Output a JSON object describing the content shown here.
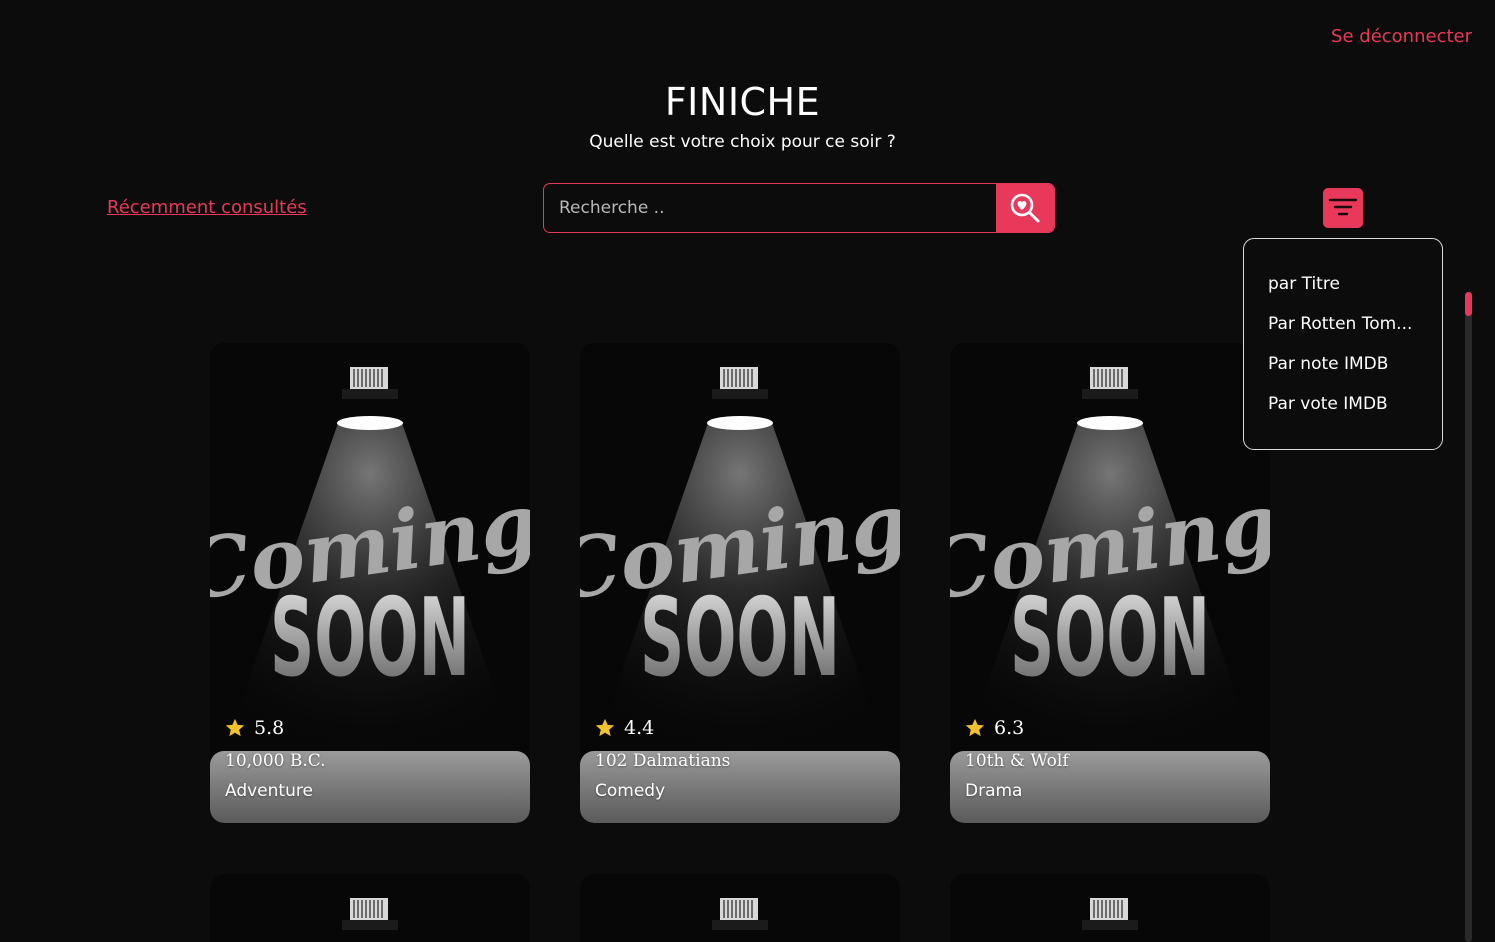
{
  "header": {
    "logout_label": "Se déconnecter",
    "brand": "FINICHE",
    "tagline": "Quelle est votre choix pour ce soir ?"
  },
  "toolbar": {
    "recent_label": "Récemment consultés",
    "search_placeholder": "Recherche ..",
    "search_icon": "magnifier-heart-icon",
    "filter_icon": "filter-lines-icon"
  },
  "sort_menu": {
    "options": [
      "par Titre",
      "Par Rotten Tom...",
      "Par note IMDB",
      "Par vote IMDB"
    ]
  },
  "movies": [
    {
      "rating": "5.8",
      "title": "10,000 B.C.",
      "genre": "Adventure",
      "poster_text_1": "Coming",
      "poster_text_2": "SOON"
    },
    {
      "rating": "4.4",
      "title": "102 Dalmatians",
      "genre": "Comedy",
      "poster_text_1": "Coming",
      "poster_text_2": "SOON"
    },
    {
      "rating": "6.3",
      "title": "10th & Wolf",
      "genre": "Drama",
      "poster_text_1": "Coming",
      "poster_text_2": "SOON"
    }
  ],
  "colors": {
    "accent": "#e8395a",
    "background": "#0c0c0c",
    "star": "#f2c12e"
  }
}
